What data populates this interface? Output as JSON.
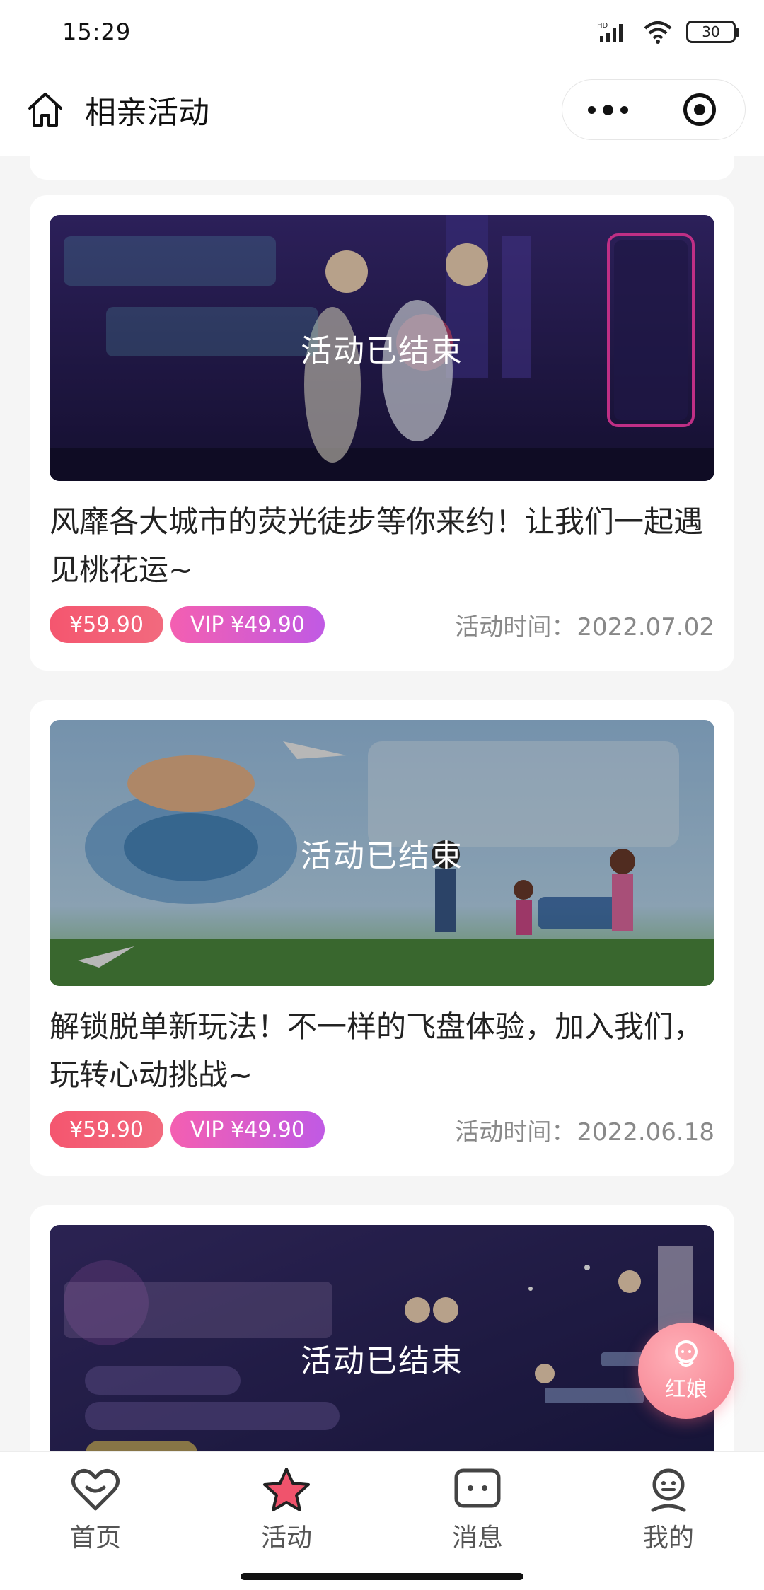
{
  "status_bar": {
    "time": "15:29",
    "battery": "30"
  },
  "nav": {
    "title": "相亲活动"
  },
  "overlay_text": "活动已结束",
  "cards": [
    {
      "banner_theme": "neon-night-street",
      "title": "风靡各大城市的荧光徒步等你来约！让我们一起遇见桃花运~",
      "price": "¥59.90",
      "vip_price": "VIP ¥49.90",
      "date_label": "活动时间：",
      "date": "2022.07.02"
    },
    {
      "banner_theme": "frisbee-sports-field",
      "title": "解锁脱单新玩法！不一样的飞盘体验，加入我们，玩转心动挑战~",
      "price": "¥59.90",
      "vip_price": "VIP ¥49.90",
      "date_label": "活动时间：",
      "date": "2022.06.18"
    },
    {
      "banner_theme": "night-apartment",
      "title": "",
      "price": "",
      "vip_price": "",
      "date_label": "",
      "date": ""
    }
  ],
  "float_button": {
    "label": "红娘"
  },
  "tabs": [
    {
      "label": "首页",
      "icon": "heart-face-icon",
      "active": false
    },
    {
      "label": "活动",
      "icon": "star-icon",
      "active": true
    },
    {
      "label": "消息",
      "icon": "message-icon",
      "active": false
    },
    {
      "label": "我的",
      "icon": "user-icon",
      "active": false
    }
  ],
  "colors": {
    "accent": "#f4566f",
    "vip": "#c05ae4",
    "star": "#f0536c"
  }
}
